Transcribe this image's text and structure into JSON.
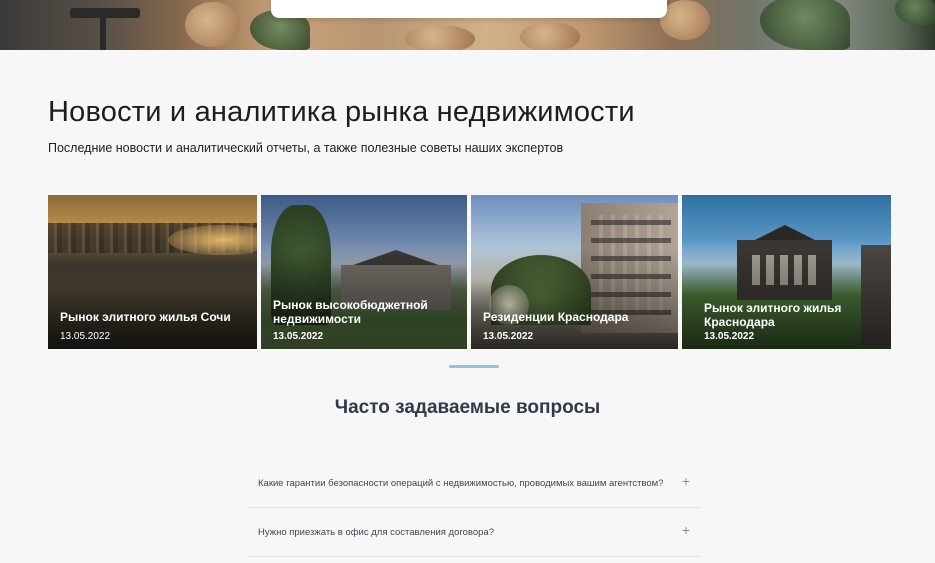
{
  "news": {
    "title": "Новости и аналитика рынка недвижимости",
    "subtitle": "Последние новости и аналитический отчеты, а также полезные советы наших экспертов",
    "cards": [
      {
        "title": "Рынок элитного жилья Сочи",
        "date": "13.05.2022"
      },
      {
        "title": "Рынок высокобюджетной недвижимости",
        "date": "13.05.2022"
      },
      {
        "title": "Резиденции Краснодара",
        "date": "13.05.2022"
      },
      {
        "title": "Рынок элитного жилья Краснодара",
        "date": "13.05.2022"
      }
    ]
  },
  "faq": {
    "title": "Часто задаваемые вопросы",
    "items": [
      {
        "question": "Какие гарантии безопасности операций с недвижимостью, проводимых вашим агентством?",
        "icon": "+"
      },
      {
        "question": "Нужно приезжать в офис для составления договора?",
        "icon": "+"
      }
    ]
  },
  "colors": {
    "background": "#f7f7f7",
    "accent_divider": "#8fc3e6",
    "faq_title": "#2f3a4a"
  }
}
